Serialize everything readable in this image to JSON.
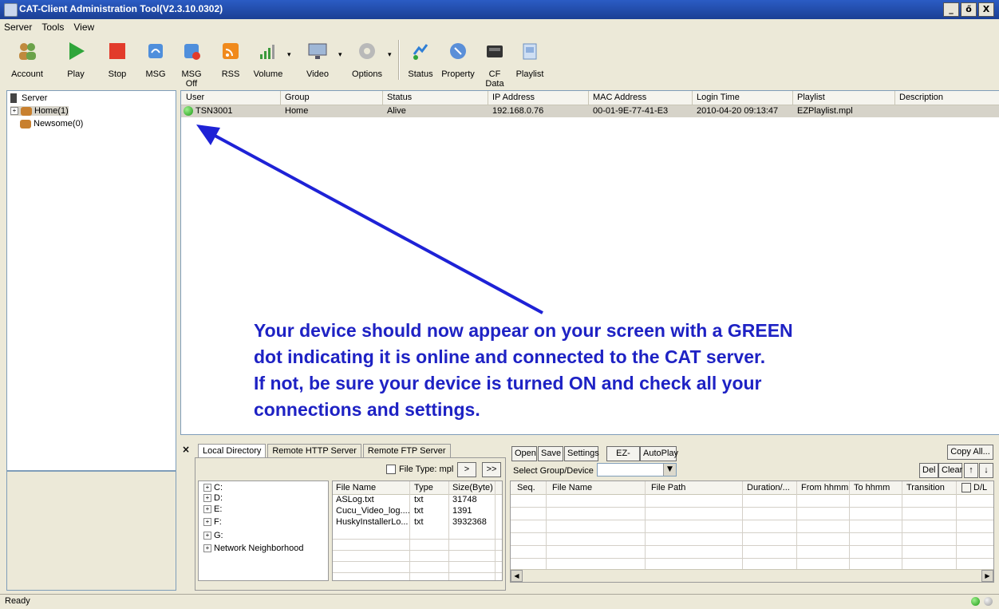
{
  "window": {
    "title": "CAT-Client Administration Tool(V2.3.10.0302)",
    "min": "_",
    "max": "ő",
    "close": "X"
  },
  "menu": [
    "Server",
    "Tools",
    "View"
  ],
  "toolbar": {
    "account": "Account",
    "play": "Play",
    "stop": "Stop",
    "msg": "MSG",
    "msg_off": "MSG Off",
    "rss": "RSS",
    "volume": "Volume",
    "video": "Video",
    "options": "Options",
    "status": "Status",
    "property": "Property",
    "cf_data": "CF Data",
    "playlist": "Playlist"
  },
  "tree": {
    "root": "Server",
    "items": [
      "Home(1)",
      "Newsome(0)"
    ]
  },
  "list": {
    "columns": [
      "User",
      "Group",
      "Status",
      "IP Address",
      "MAC Address",
      "Login Time",
      "Playlist",
      "Description"
    ],
    "rows": [
      {
        "user": "TSN3001",
        "group": "Home",
        "status": "Alive",
        "ip": "192.168.0.76",
        "mac": "00-01-9E-77-41-E3",
        "login": "2010-04-20 09:13:47",
        "playlist": "EZPlaylist.mpl",
        "desc": ""
      }
    ]
  },
  "annotation": {
    "line1": "Your device should now appear on your screen with a GREEN",
    "line2": "dot indicating it is online and connected to the CAT server.",
    "line3": "If not, be sure your device is turned ON and check all your",
    "line4": "connections and settings."
  },
  "bottom": {
    "close": "×",
    "tabs": [
      "Local Directory",
      "Remote HTTP Server",
      "Remote FTP Server"
    ],
    "file_type_label": "File Type: mpl",
    "nav_next": ">",
    "nav_all": ">>",
    "drives": [
      "C:",
      "D:",
      "E:",
      "F:",
      "G:",
      "Network Neighborhood"
    ],
    "file_columns": [
      "File Name",
      "Type",
      "Size(Byte)"
    ],
    "files": [
      {
        "name": "ASLog.txt",
        "type": "txt",
        "size": "31748"
      },
      {
        "name": "Cucu_Video_log....",
        "type": "txt",
        "size": "1391"
      },
      {
        "name": "HuskyInstallerLo...",
        "type": "txt",
        "size": "3932368"
      }
    ],
    "buttons": {
      "open": "Open",
      "save": "Save",
      "settings": "Settings",
      "ez_play": "EZ-Play",
      "autoplay": "AutoPlay",
      "copy_all": "Copy All...",
      "del": "Del",
      "clear": "Clear",
      "up": "↑",
      "down": "↓"
    },
    "select_label": "Select Group/Device",
    "playlist_columns": [
      "Seq.",
      "File Name",
      "File Path",
      "Duration/...",
      "From hhmm",
      "To hhmm",
      "Transition",
      "D/L"
    ]
  },
  "status": {
    "text": "Ready"
  }
}
